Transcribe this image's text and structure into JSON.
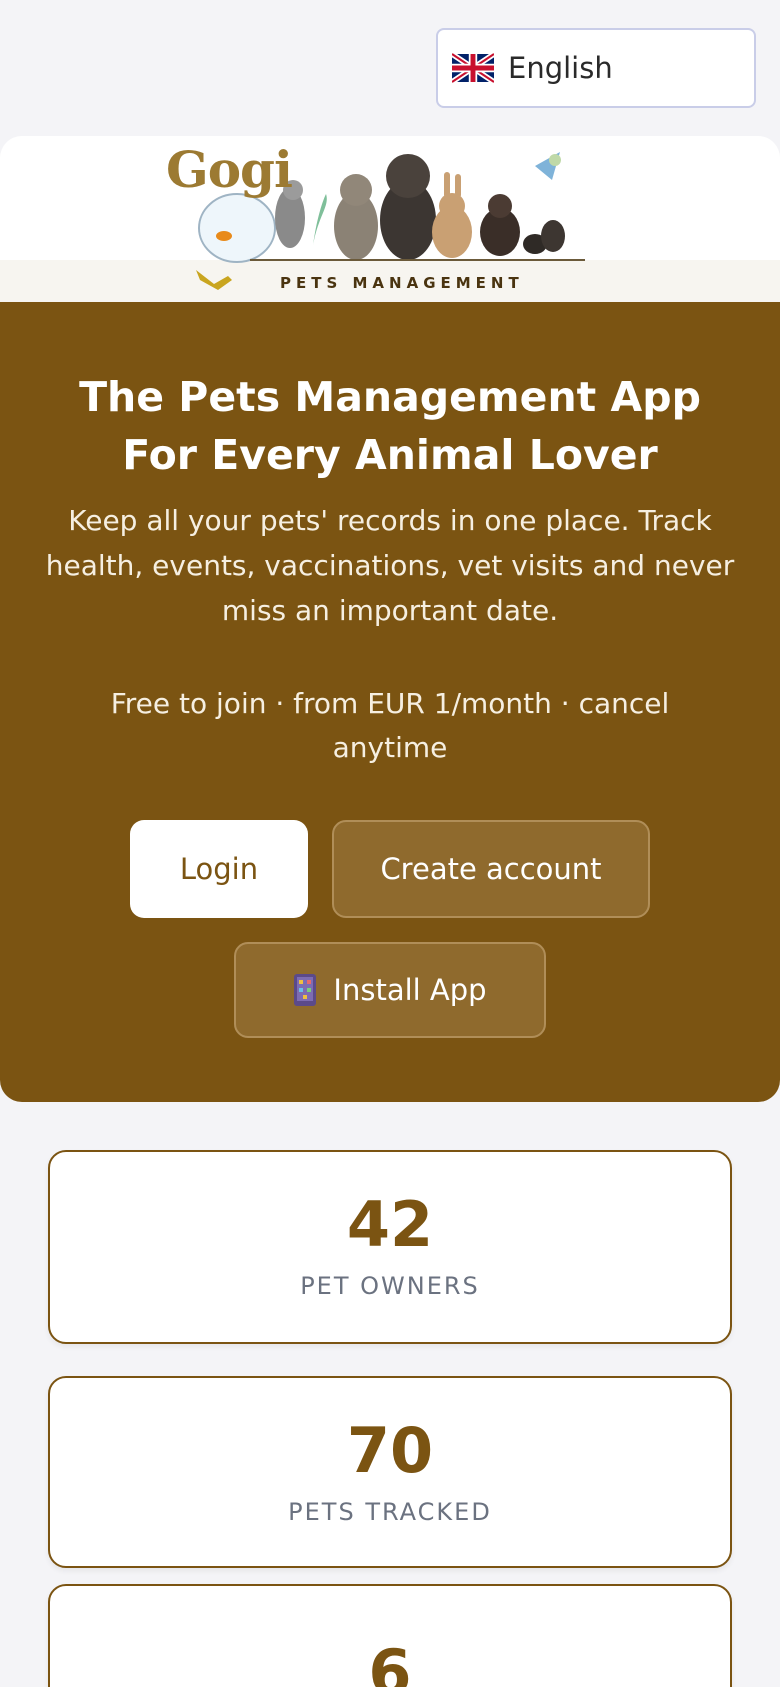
{
  "language": {
    "selected": "English",
    "flag_icon": "uk-flag-icon"
  },
  "brand": {
    "name": "Gogi",
    "tagline": "PETS MANAGEMENT"
  },
  "hero": {
    "title": "The Pets Management App For Every Animal Lover",
    "lead": "Keep all your pets' records in one place. Track health, events, vaccinations, vet visits and never miss an important date.",
    "pricing": "Free to join · from EUR 1/month · cancel anytime",
    "login_label": "Login",
    "create_account_label": "Create account",
    "install_label": "Install App",
    "install_icon": "phone-icon"
  },
  "stats": [
    {
      "value": "42",
      "label": "PET OWNERS"
    },
    {
      "value": "70",
      "label": "PETS TRACKED"
    },
    {
      "value": "6",
      "label": ""
    }
  ],
  "colors": {
    "primary": "#7b5412",
    "background": "#f4f4f7",
    "muted_text": "#6b7280"
  }
}
